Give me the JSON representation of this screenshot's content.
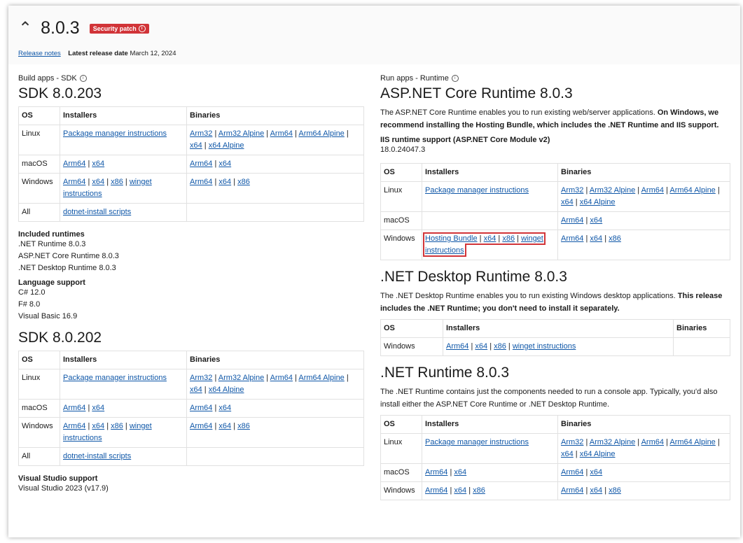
{
  "header": {
    "version": "8.0.3",
    "badge": "Security patch",
    "release_notes": "Release notes",
    "latest_label": "Latest release date",
    "latest_date": "March 12, 2024"
  },
  "left": {
    "section_title": "Build apps - SDK",
    "cols": [
      "OS",
      "Installers",
      "Binaries"
    ],
    "sdks": [
      {
        "title": "SDK 8.0.203",
        "rows": [
          {
            "os": "Linux",
            "inst": [
              "Package manager instructions"
            ],
            "bin": [
              "Arm32",
              "Arm32 Alpine",
              "Arm64",
              "Arm64 Alpine",
              "x64",
              "x64 Alpine"
            ]
          },
          {
            "os": "macOS",
            "inst": [
              "Arm64",
              "x64"
            ],
            "bin": [
              "Arm64",
              "x64"
            ]
          },
          {
            "os": "Windows",
            "inst": [
              "Arm64",
              "x64",
              "x86",
              "winget instructions"
            ],
            "bin": [
              "Arm64",
              "x64",
              "x86"
            ]
          },
          {
            "os": "All",
            "inst": [
              "dotnet-install scripts"
            ],
            "bin": []
          }
        ],
        "extras": [
          {
            "title": "Included runtimes",
            "items": [
              ".NET Runtime 8.0.3",
              "ASP.NET Core Runtime 8.0.3",
              ".NET Desktop Runtime 8.0.3"
            ]
          },
          {
            "title": "Language support",
            "items": [
              "C# 12.0",
              "F# 8.0",
              "Visual Basic 16.9"
            ]
          }
        ]
      },
      {
        "title": "SDK 8.0.202",
        "rows": [
          {
            "os": "Linux",
            "inst": [
              "Package manager instructions"
            ],
            "bin": [
              "Arm32",
              "Arm32 Alpine",
              "Arm64",
              "Arm64 Alpine",
              "x64",
              "x64 Alpine"
            ]
          },
          {
            "os": "macOS",
            "inst": [
              "Arm64",
              "x64"
            ],
            "bin": [
              "Arm64",
              "x64"
            ]
          },
          {
            "os": "Windows",
            "inst": [
              "Arm64",
              "x64",
              "x86",
              "winget instructions"
            ],
            "bin": [
              "Arm64",
              "x64",
              "x86"
            ]
          },
          {
            "os": "All",
            "inst": [
              "dotnet-install scripts"
            ],
            "bin": []
          }
        ],
        "extras": [
          {
            "title": "Visual Studio support",
            "items": [
              "Visual Studio 2023 (v17.9)"
            ]
          }
        ]
      }
    ]
  },
  "right": {
    "section_title": "Run apps - Runtime",
    "runtimes": [
      {
        "title": "ASP.NET Core Runtime 8.0.3",
        "desc_plain": "The ASP.NET Core Runtime enables you to run existing web/server applications. ",
        "desc_bold": "On Windows, we recommend installing the Hosting Bundle, which includes the .NET Runtime and IIS support.",
        "iis_title": "IIS runtime support (ASP.NET Core Module v2)",
        "iis_version": "18.0.24047.3",
        "cols": [
          "OS",
          "Installers",
          "Binaries"
        ],
        "rows": [
          {
            "os": "Linux",
            "inst": [
              "Package manager instructions"
            ],
            "bin": [
              "Arm32",
              "Arm32 Alpine",
              "Arm64",
              "Arm64 Alpine",
              "x64",
              "x64 Alpine"
            ]
          },
          {
            "os": "macOS",
            "inst": [],
            "bin": [
              "Arm64",
              "x64"
            ]
          },
          {
            "os": "Windows",
            "inst": [
              "Hosting Bundle",
              "x64",
              "x86",
              "winget instructions"
            ],
            "bin": [
              "Arm64",
              "x64",
              "x86"
            ],
            "highlight": true
          }
        ]
      },
      {
        "title": ".NET Desktop Runtime 8.0.3",
        "desc_plain": "The .NET Desktop Runtime enables you to run existing Windows desktop applications. ",
        "desc_bold": "This release includes the .NET Runtime; you don't need to install it separately.",
        "cols": [
          "OS",
          "Installers",
          "Binaries"
        ],
        "rows": [
          {
            "os": "Windows",
            "inst": [
              "Arm64",
              "x64",
              "x86",
              "winget instructions"
            ],
            "bin": []
          }
        ]
      },
      {
        "title": ".NET Runtime 8.0.3",
        "desc_plain": "The .NET Runtime contains just the components needed to run a console app. Typically, you'd also install either the ASP.NET Core Runtime or .NET Desktop Runtime.",
        "desc_bold": "",
        "cols": [
          "OS",
          "Installers",
          "Binaries"
        ],
        "rows": [
          {
            "os": "Linux",
            "inst": [
              "Package manager instructions"
            ],
            "bin": [
              "Arm32",
              "Arm32 Alpine",
              "Arm64",
              "Arm64 Alpine",
              "x64",
              "x64 Alpine"
            ]
          },
          {
            "os": "macOS",
            "inst": [
              "Arm64",
              "x64"
            ],
            "bin": [
              "Arm64",
              "x64"
            ]
          },
          {
            "os": "Windows",
            "inst": [
              "Arm64",
              "x64",
              "x86"
            ],
            "bin": [
              "Arm64",
              "x64",
              "x86"
            ]
          }
        ]
      }
    ]
  },
  "colors": {
    "link": "#0f57a8",
    "badge": "#d13438",
    "highlight": "#d13438"
  }
}
